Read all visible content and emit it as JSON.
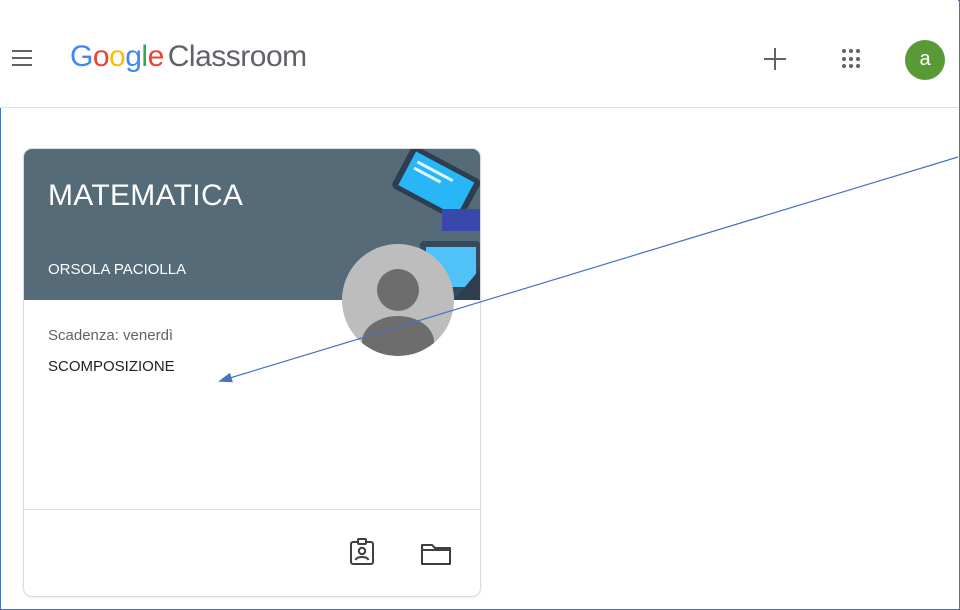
{
  "header": {
    "brand_google": [
      "G",
      "o",
      "o",
      "g",
      "l",
      "e"
    ],
    "brand_product": "Classroom",
    "menu_icon": "hamburger-menu-icon",
    "create_icon": "plus-icon",
    "apps_icon": "apps-grid-icon",
    "account_initial": "a",
    "account_color": "#5a9a36"
  },
  "card": {
    "class_name": "MATEMATICA",
    "teacher": "ORSOLA PACIOLLA",
    "due_label": "Scadenza: venerdì",
    "assignment": "SCOMPOSIZIONE",
    "banner_color": "#566b78",
    "footer_icons": [
      "assignment-ind-icon",
      "folder-icon"
    ]
  },
  "annotation": {
    "arrow_color": "#4472c4"
  }
}
